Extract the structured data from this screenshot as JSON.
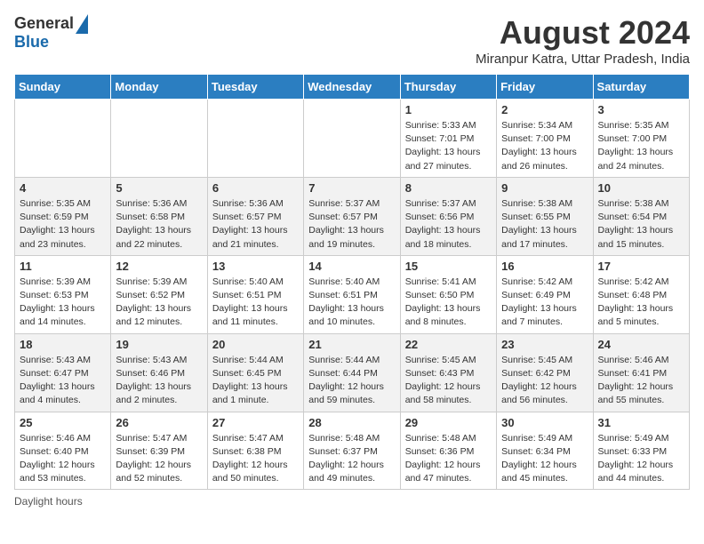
{
  "logo": {
    "general": "General",
    "blue": "Blue"
  },
  "title": {
    "month_year": "August 2024",
    "location": "Miranpur Katra, Uttar Pradesh, India"
  },
  "weekdays": [
    "Sunday",
    "Monday",
    "Tuesday",
    "Wednesday",
    "Thursday",
    "Friday",
    "Saturday"
  ],
  "footer": {
    "daylight": "Daylight hours"
  },
  "weeks": [
    [
      {
        "day": "",
        "info": ""
      },
      {
        "day": "",
        "info": ""
      },
      {
        "day": "",
        "info": ""
      },
      {
        "day": "",
        "info": ""
      },
      {
        "day": "1",
        "info": "Sunrise: 5:33 AM\nSunset: 7:01 PM\nDaylight: 13 hours\nand 27 minutes."
      },
      {
        "day": "2",
        "info": "Sunrise: 5:34 AM\nSunset: 7:00 PM\nDaylight: 13 hours\nand 26 minutes."
      },
      {
        "day": "3",
        "info": "Sunrise: 5:35 AM\nSunset: 7:00 PM\nDaylight: 13 hours\nand 24 minutes."
      }
    ],
    [
      {
        "day": "4",
        "info": "Sunrise: 5:35 AM\nSunset: 6:59 PM\nDaylight: 13 hours\nand 23 minutes."
      },
      {
        "day": "5",
        "info": "Sunrise: 5:36 AM\nSunset: 6:58 PM\nDaylight: 13 hours\nand 22 minutes."
      },
      {
        "day": "6",
        "info": "Sunrise: 5:36 AM\nSunset: 6:57 PM\nDaylight: 13 hours\nand 21 minutes."
      },
      {
        "day": "7",
        "info": "Sunrise: 5:37 AM\nSunset: 6:57 PM\nDaylight: 13 hours\nand 19 minutes."
      },
      {
        "day": "8",
        "info": "Sunrise: 5:37 AM\nSunset: 6:56 PM\nDaylight: 13 hours\nand 18 minutes."
      },
      {
        "day": "9",
        "info": "Sunrise: 5:38 AM\nSunset: 6:55 PM\nDaylight: 13 hours\nand 17 minutes."
      },
      {
        "day": "10",
        "info": "Sunrise: 5:38 AM\nSunset: 6:54 PM\nDaylight: 13 hours\nand 15 minutes."
      }
    ],
    [
      {
        "day": "11",
        "info": "Sunrise: 5:39 AM\nSunset: 6:53 PM\nDaylight: 13 hours\nand 14 minutes."
      },
      {
        "day": "12",
        "info": "Sunrise: 5:39 AM\nSunset: 6:52 PM\nDaylight: 13 hours\nand 12 minutes."
      },
      {
        "day": "13",
        "info": "Sunrise: 5:40 AM\nSunset: 6:51 PM\nDaylight: 13 hours\nand 11 minutes."
      },
      {
        "day": "14",
        "info": "Sunrise: 5:40 AM\nSunset: 6:51 PM\nDaylight: 13 hours\nand 10 minutes."
      },
      {
        "day": "15",
        "info": "Sunrise: 5:41 AM\nSunset: 6:50 PM\nDaylight: 13 hours\nand 8 minutes."
      },
      {
        "day": "16",
        "info": "Sunrise: 5:42 AM\nSunset: 6:49 PM\nDaylight: 13 hours\nand 7 minutes."
      },
      {
        "day": "17",
        "info": "Sunrise: 5:42 AM\nSunset: 6:48 PM\nDaylight: 13 hours\nand 5 minutes."
      }
    ],
    [
      {
        "day": "18",
        "info": "Sunrise: 5:43 AM\nSunset: 6:47 PM\nDaylight: 13 hours\nand 4 minutes."
      },
      {
        "day": "19",
        "info": "Sunrise: 5:43 AM\nSunset: 6:46 PM\nDaylight: 13 hours\nand 2 minutes."
      },
      {
        "day": "20",
        "info": "Sunrise: 5:44 AM\nSunset: 6:45 PM\nDaylight: 13 hours\nand 1 minute."
      },
      {
        "day": "21",
        "info": "Sunrise: 5:44 AM\nSunset: 6:44 PM\nDaylight: 12 hours\nand 59 minutes."
      },
      {
        "day": "22",
        "info": "Sunrise: 5:45 AM\nSunset: 6:43 PM\nDaylight: 12 hours\nand 58 minutes."
      },
      {
        "day": "23",
        "info": "Sunrise: 5:45 AM\nSunset: 6:42 PM\nDaylight: 12 hours\nand 56 minutes."
      },
      {
        "day": "24",
        "info": "Sunrise: 5:46 AM\nSunset: 6:41 PM\nDaylight: 12 hours\nand 55 minutes."
      }
    ],
    [
      {
        "day": "25",
        "info": "Sunrise: 5:46 AM\nSunset: 6:40 PM\nDaylight: 12 hours\nand 53 minutes."
      },
      {
        "day": "26",
        "info": "Sunrise: 5:47 AM\nSunset: 6:39 PM\nDaylight: 12 hours\nand 52 minutes."
      },
      {
        "day": "27",
        "info": "Sunrise: 5:47 AM\nSunset: 6:38 PM\nDaylight: 12 hours\nand 50 minutes."
      },
      {
        "day": "28",
        "info": "Sunrise: 5:48 AM\nSunset: 6:37 PM\nDaylight: 12 hours\nand 49 minutes."
      },
      {
        "day": "29",
        "info": "Sunrise: 5:48 AM\nSunset: 6:36 PM\nDaylight: 12 hours\nand 47 minutes."
      },
      {
        "day": "30",
        "info": "Sunrise: 5:49 AM\nSunset: 6:34 PM\nDaylight: 12 hours\nand 45 minutes."
      },
      {
        "day": "31",
        "info": "Sunrise: 5:49 AM\nSunset: 6:33 PM\nDaylight: 12 hours\nand 44 minutes."
      }
    ]
  ]
}
